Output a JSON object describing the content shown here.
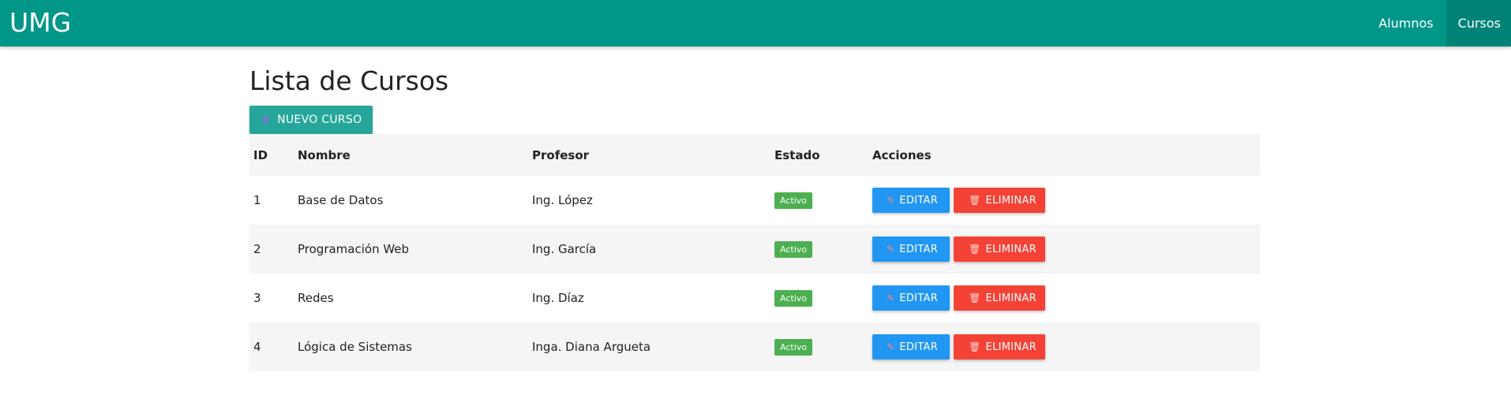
{
  "navbar": {
    "brand": "UMG",
    "links": [
      {
        "label": "Alumnos",
        "active": false
      },
      {
        "label": "Cursos",
        "active": true
      }
    ]
  },
  "page": {
    "title": "Lista de Cursos",
    "new_button": {
      "icon": "plus-icon",
      "label": "NUEVO CURSO"
    }
  },
  "table": {
    "headers": {
      "id": "ID",
      "nombre": "Nombre",
      "profesor": "Profesor",
      "estado": "Estado",
      "acciones": "Acciones"
    },
    "rows": [
      {
        "id": "1",
        "nombre": "Base de Datos",
        "profesor": "Ing. López",
        "estado": "Activo"
      },
      {
        "id": "2",
        "nombre": "Programación Web",
        "profesor": "Ing. García",
        "estado": "Activo"
      },
      {
        "id": "3",
        "nombre": "Redes",
        "profesor": "Ing. Díaz",
        "estado": "Activo"
      },
      {
        "id": "4",
        "nombre": "Lógica de Sistemas",
        "profesor": "Inga. Diana Argueta",
        "estado": "Activo"
      }
    ],
    "actions": {
      "edit": {
        "icon": "pencil-icon",
        "label": "EDITAR"
      },
      "delete": {
        "icon": "trash-icon",
        "label": "ELIMINAR"
      }
    }
  },
  "colors": {
    "navbar": "#009688",
    "new_button": "#26a69a",
    "edit_button": "#2196f3",
    "delete_button": "#f44336",
    "status_badge": "#4caf50"
  }
}
